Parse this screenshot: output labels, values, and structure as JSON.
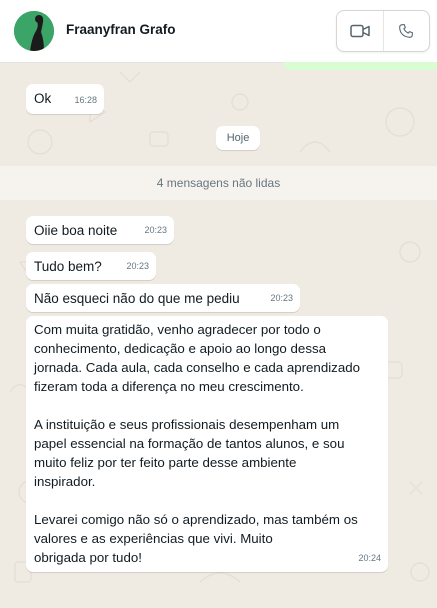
{
  "header": {
    "contact_name": "Fraanyfran Grafo",
    "video_icon": "video-camera-icon",
    "call_icon": "phone-icon"
  },
  "messages_top": [
    {
      "text": "Ok",
      "time": "16:28"
    }
  ],
  "date_chip": "Hoje",
  "unread_label": "4 mensagens não lidas",
  "messages": [
    {
      "text": "Oiie boa noite",
      "time": "20:23"
    },
    {
      "text": "Tudo bem?",
      "time": "20:23"
    },
    {
      "text": "Não esqueci não do que me pediu",
      "time": "20:23"
    },
    {
      "text": "Com muita gratidão, venho agradecer por todo o\nconhecimento, dedicação e apoio ao longo dessa\njornada. Cada aula, cada conselho e cada aprendizado\nfizeram toda a diferença no meu crescimento.\n\nA instituição e seus profissionais desempenham um\npapel essencial na formação de tantos alunos, e sou\nmuito feliz por ter feito parte desse ambiente\ninspirador.\n\nLevarei comigo não só o aprendizado, mas também os\nvalores e as experiências que vivi. Muito\nobrigada por tudo!",
      "time": "20:24"
    }
  ],
  "colors": {
    "chat_bg": "#efeae2",
    "bubble_in": "#ffffff",
    "bubble_out_strip": "#d9fdd3",
    "avatar_bg": "#2e9b5d"
  }
}
